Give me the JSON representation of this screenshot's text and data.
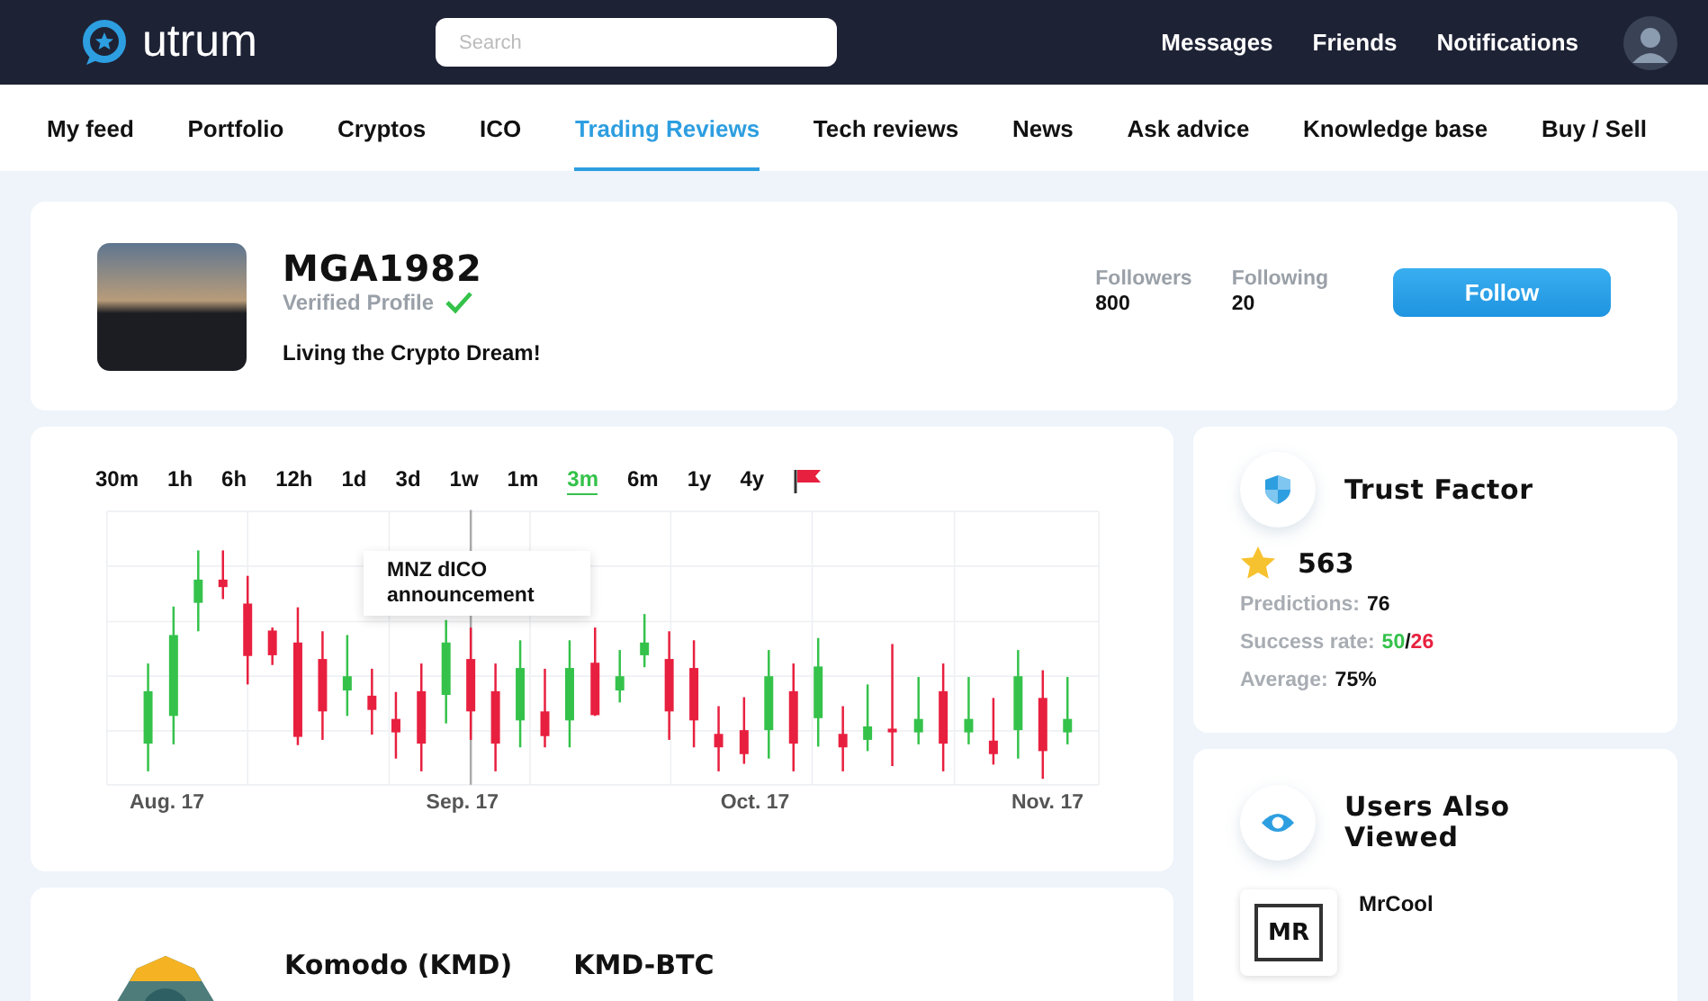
{
  "header": {
    "logo": "utrum",
    "search": {
      "placeholder": "Search"
    },
    "links": [
      "Messages",
      "Friends",
      "Notifications"
    ]
  },
  "nav": {
    "tabs": [
      {
        "label": "My feed",
        "selected": false
      },
      {
        "label": "Portfolio",
        "selected": false
      },
      {
        "label": "Cryptos",
        "selected": false
      },
      {
        "label": "ICO",
        "selected": false
      },
      {
        "label": "Trading Reviews",
        "selected": true
      },
      {
        "label": "Tech reviews",
        "selected": false
      },
      {
        "label": "News",
        "selected": false
      },
      {
        "label": "Ask advice",
        "selected": false
      },
      {
        "label": "Knowledge base",
        "selected": false
      },
      {
        "label": "Buy / Sell",
        "selected": false
      }
    ]
  },
  "profile": {
    "name": "MGA1982",
    "verified_label": "Verified Profile",
    "verified": true,
    "bio": "Living the Crypto Dream!",
    "stats": [
      {
        "label": "Followers",
        "value": "800"
      },
      {
        "label": "Following",
        "value": "20"
      }
    ],
    "follow_button": "Follow"
  },
  "chart": {
    "ranges": [
      {
        "label": "30m",
        "selected": false
      },
      {
        "label": "1h",
        "selected": false
      },
      {
        "label": "6h",
        "selected": false
      },
      {
        "label": "12h",
        "selected": false
      },
      {
        "label": "1d",
        "selected": false
      },
      {
        "label": "3d",
        "selected": false
      },
      {
        "label": "1w",
        "selected": false
      },
      {
        "label": "1m",
        "selected": false
      },
      {
        "label": "3m",
        "selected": true
      },
      {
        "label": "6m",
        "selected": false
      },
      {
        "label": "1y",
        "selected": false
      },
      {
        "label": "4y",
        "selected": false
      }
    ],
    "tooltip": "MNZ dICO announcement",
    "x_labels": [
      "Aug. 17",
      "Sep. 17",
      "Oct. 17",
      "Nov. 17"
    ]
  },
  "trust": {
    "title": "Trust Factor",
    "score": "563",
    "rows": [
      {
        "kind": "plain",
        "label": "Predictions:",
        "value": "76"
      },
      {
        "kind": "ratio",
        "label": "Success rate:",
        "good": "50",
        "separator": "/",
        "bad": "26"
      },
      {
        "kind": "plain",
        "label": "Average:",
        "value": "75%"
      }
    ]
  },
  "users": {
    "title": "Users Also Viewed",
    "items": [
      {
        "initials": "MR",
        "name": "MrCool"
      }
    ]
  },
  "coin": {
    "name": "Komodo (KMD)",
    "pair": "KMD-BTC"
  }
}
